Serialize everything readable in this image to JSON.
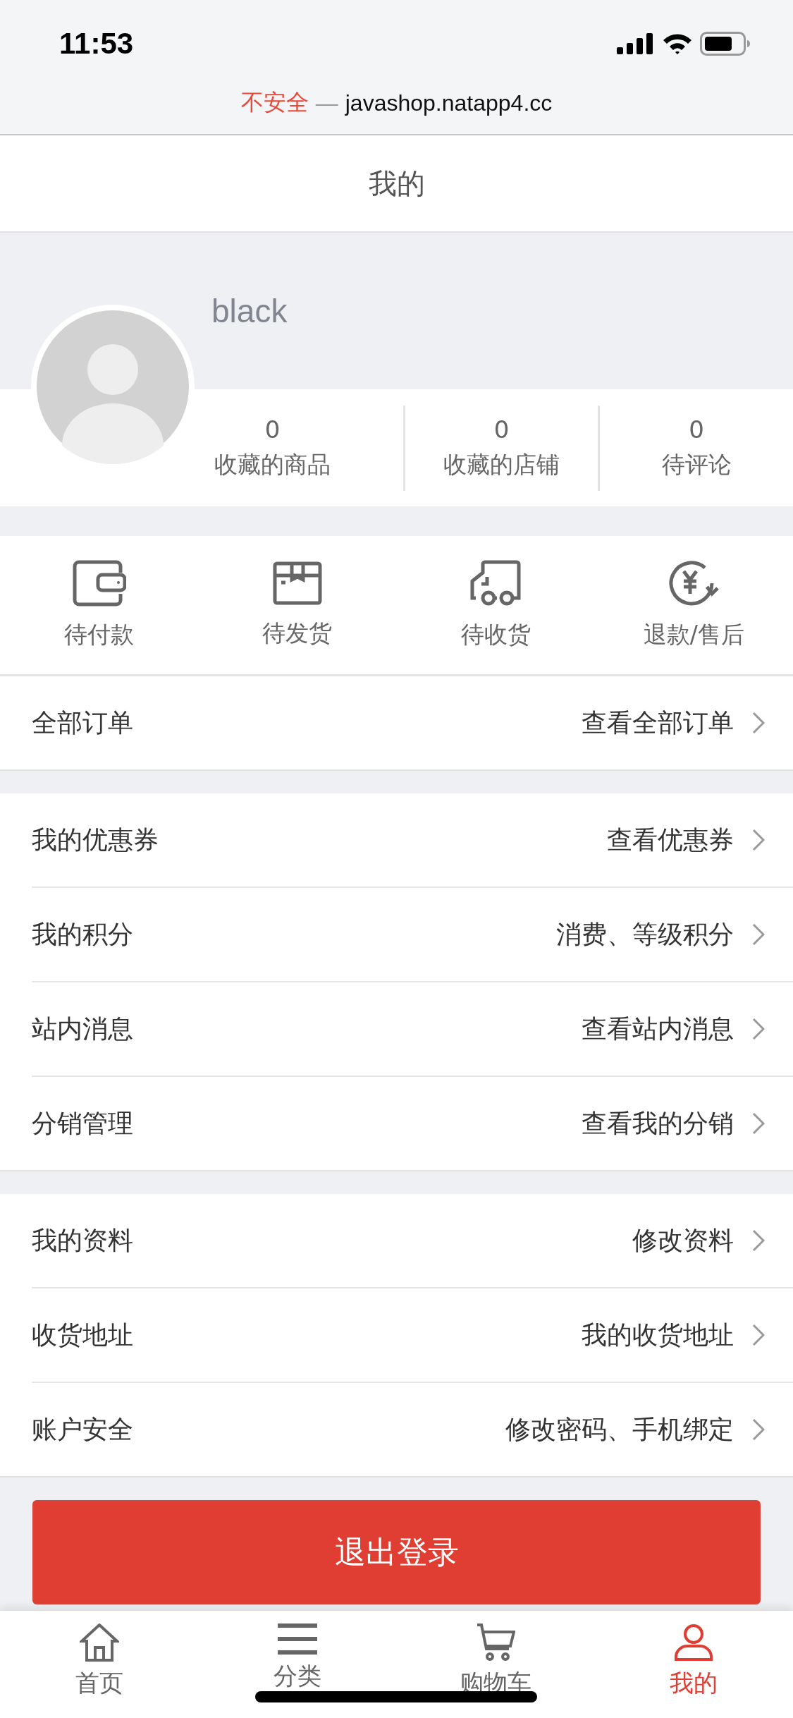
{
  "status_bar": {
    "time": "11:53"
  },
  "browser": {
    "security": "不安全",
    "separator": "—",
    "url": "javashop.natapp4.cc"
  },
  "header": {
    "title": "我的"
  },
  "profile": {
    "username": "black",
    "stats": [
      {
        "value": "0",
        "label": "收藏的商品"
      },
      {
        "value": "0",
        "label": "收藏的店铺"
      },
      {
        "value": "0",
        "label": "待评论"
      }
    ]
  },
  "order_shortcuts": [
    {
      "kind": "wallet",
      "label": "待付款"
    },
    {
      "kind": "box",
      "label": "待发货"
    },
    {
      "kind": "truck",
      "label": "待收货"
    },
    {
      "kind": "refund",
      "label": "退款/售后"
    }
  ],
  "menu_groups": [
    [
      {
        "label": "全部订单",
        "hint": "查看全部订单"
      }
    ],
    [
      {
        "label": "我的优惠券",
        "hint": "查看优惠券"
      },
      {
        "label": "我的积分",
        "hint": "消费、等级积分"
      },
      {
        "label": "站内消息",
        "hint": "查看站内消息"
      },
      {
        "label": "分销管理",
        "hint": "查看我的分销"
      }
    ],
    [
      {
        "label": "我的资料",
        "hint": "修改资料"
      },
      {
        "label": "收货地址",
        "hint": "我的收货地址"
      },
      {
        "label": "账户安全",
        "hint": "修改密码、手机绑定"
      }
    ]
  ],
  "logout_button": "退出登录",
  "tab_bar": [
    {
      "kind": "home",
      "label": "首页",
      "selected": false
    },
    {
      "kind": "menu",
      "label": "分类",
      "selected": false
    },
    {
      "kind": "cart",
      "label": "购物车",
      "selected": false
    },
    {
      "kind": "person",
      "label": "我的",
      "selected": true
    }
  ]
}
